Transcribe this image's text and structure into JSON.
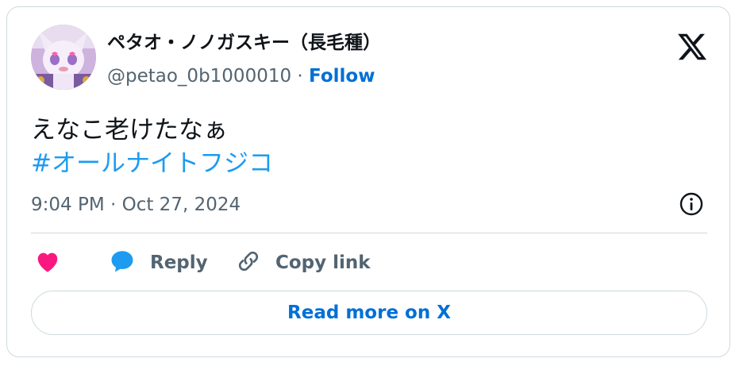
{
  "tweet": {
    "display_name": "ペタオ・ノノガスキー（長毛種）",
    "handle": "@petao_0b1000010",
    "separator": "·",
    "follow_label": "Follow",
    "text": "えなこ老けたなぁ",
    "hashtag": "#オールナイトフジコ",
    "timestamp": "9:04 PM · Oct 27, 2024"
  },
  "actions": {
    "like_icon": "heart-icon",
    "reply_icon": "speech-bubble-icon",
    "reply_label": "Reply",
    "copy_link_icon": "link-icon",
    "copy_link_label": "Copy link"
  },
  "footer": {
    "read_more_label": "Read more on X"
  },
  "icons": {
    "logo": "x-logo-icon",
    "info": "info-icon"
  },
  "colors": {
    "like": "#f91880",
    "reply_icon": "#1d9bf0",
    "hashtag": "#1d9bf0",
    "follow": "#006fd6",
    "secondary_text": "#536471",
    "border": "#cfd9de"
  }
}
